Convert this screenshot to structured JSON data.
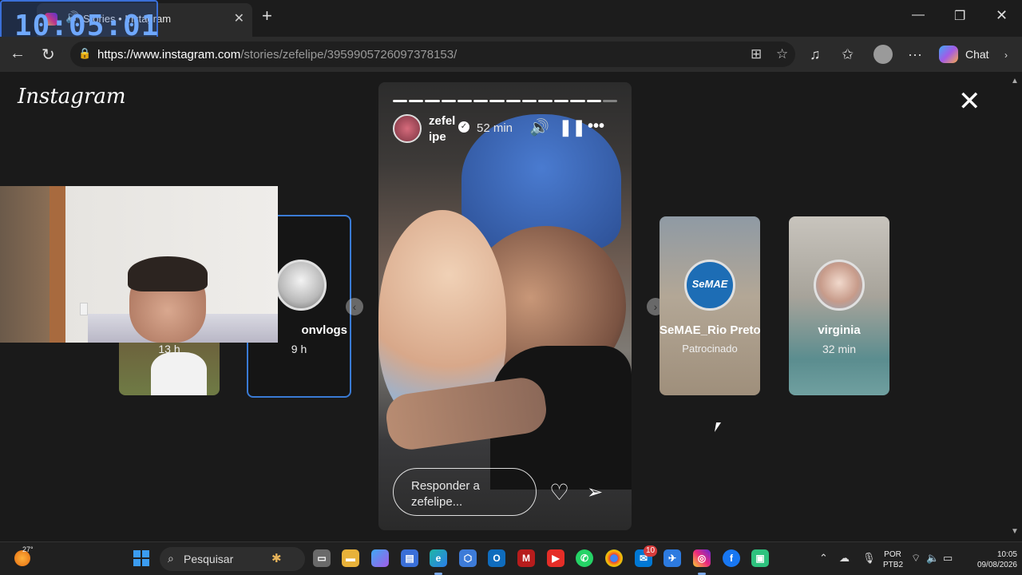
{
  "overlay_clock": "10:05:01",
  "browser": {
    "tab_title": "Stories • Instagram",
    "new_tab": "+",
    "url_host": "https://www.instagram.com",
    "url_path": "/stories/zefelipe/3959905726097378153/",
    "chat_label": "Chat"
  },
  "page": {
    "logo": "Instagram",
    "close": "✕"
  },
  "left_cards": [
    {
      "name": "",
      "sub": "13 h"
    },
    {
      "name": "onvlogs",
      "sub": "9 h"
    }
  ],
  "story": {
    "username": "zefelipe",
    "username_line1": "zefel",
    "username_line2": "ipe",
    "time": "52 min",
    "segments_total": 14,
    "progress_fraction": 0.93,
    "reply_placeholder": "Responder a zefelipe...",
    "reply_line1": "Responder a",
    "reply_line2": "zefelipe..."
  },
  "right_cards": [
    {
      "name": "SeMAE_Rio Preto",
      "sub": "Patrocinado",
      "logo_text": "SeMAE"
    },
    {
      "name": "virginia",
      "sub": "32 min"
    }
  ],
  "taskbar": {
    "temperature": "27°",
    "search": "Pesquisar",
    "badge_count": "10",
    "lang_line1": "POR",
    "lang_line2": "PTB2",
    "time": "10:05",
    "date": "09/08/2026"
  },
  "colors": {
    "page_bg": "#1a1a1a",
    "highlight_border": "#3a7bd5",
    "chrome_bg": "#2b2b2b"
  }
}
